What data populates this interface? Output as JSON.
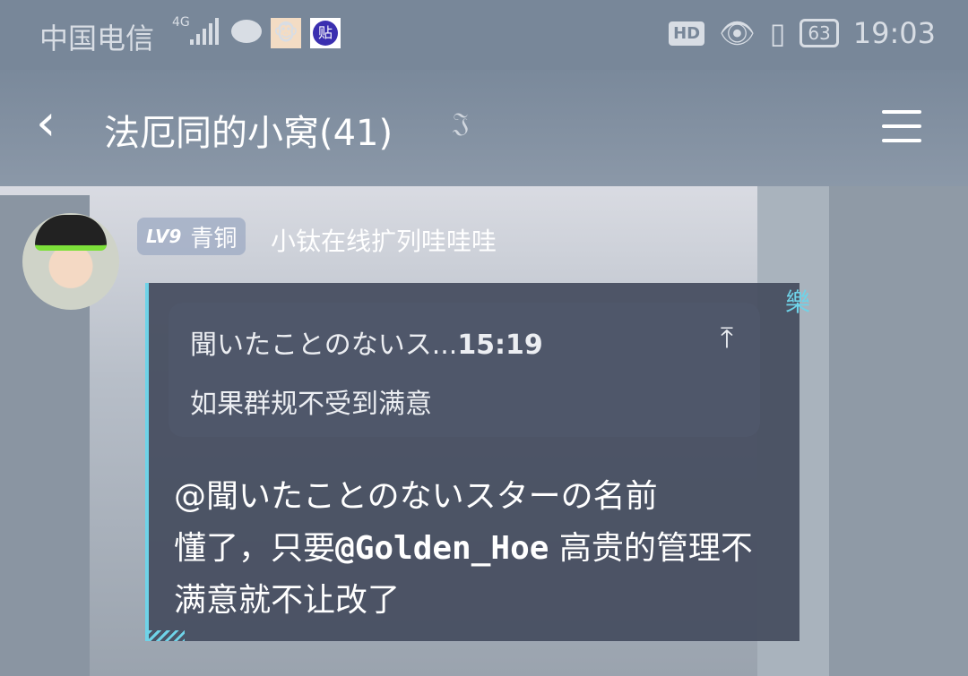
{
  "status_bar": {
    "carrier": "中国电信",
    "network": "4G",
    "app_icon_1": "monkey-app-icon",
    "app_icon_2": "贴",
    "hd": "HD",
    "battery": "63",
    "time": "19:03"
  },
  "header": {
    "title": "法厄同的小窝(41)",
    "back_icon": "chevron-left-icon",
    "ear_icon": "ear-icon",
    "menu_icon": "menu-icon"
  },
  "message": {
    "level": "LV9",
    "rank": "青铜",
    "sender": "小钛在线扩列哇哇哇",
    "quote": {
      "author": "聞いたことのないス...",
      "time": "15:19",
      "text": "如果群规不受到满意",
      "jump_icon": "arrow-up-icon"
    },
    "deco_char": "樂",
    "mention1": "@聞いたことのないスターの名前",
    "text1": "懂了，只要",
    "mention2": "@Golden_Hoe",
    "text2": " 高贵的管理不满意就不让改了"
  },
  "colors": {
    "accent": "#6fd3e8",
    "bubble": "#464e60"
  }
}
